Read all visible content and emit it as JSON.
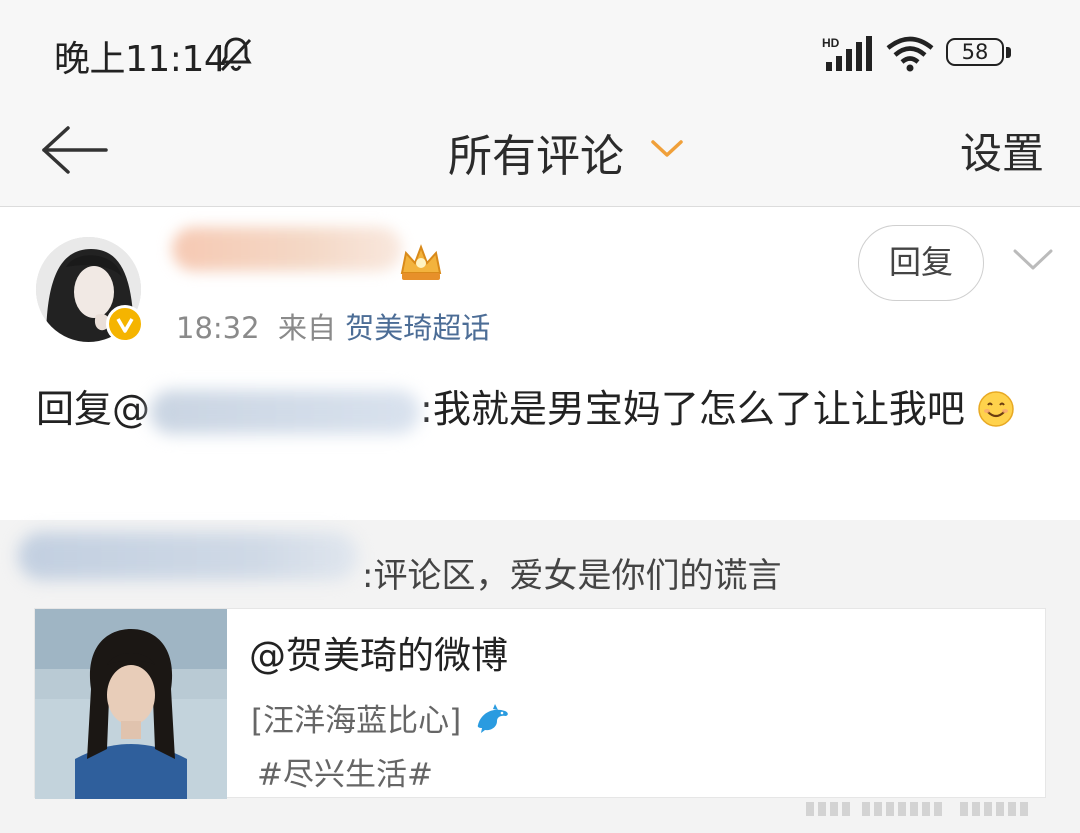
{
  "status_bar": {
    "time": "晚上11:14",
    "network": "HD",
    "battery": "58"
  },
  "nav": {
    "title": "所有评论",
    "settings_label": "设置"
  },
  "comment": {
    "time": "18:32",
    "from_label": "来自",
    "source": "贺美琦超话",
    "reply_label": "回复",
    "text_prefix": "回复@",
    "text_body": ":我就是男宝妈了怎么了让让我吧"
  },
  "quoted": {
    "text": ":评论区，爱女是你们的谎言",
    "card": {
      "title": "@贺美琦的微博",
      "line1": "[汪洋海蓝比心]",
      "line2": "#尽兴生活#"
    }
  },
  "colors": {
    "link": "#4c6d96",
    "accent": "#f0a03a",
    "verified_badge": "#f5b400"
  },
  "icons": [
    "bell-muted-icon",
    "signal-icon",
    "wifi-icon",
    "battery-icon",
    "back-arrow-icon",
    "chevron-down-icon",
    "verified-badge-icon",
    "crown-badge-icon",
    "smile-emoji-icon",
    "dolphin-icon"
  ]
}
